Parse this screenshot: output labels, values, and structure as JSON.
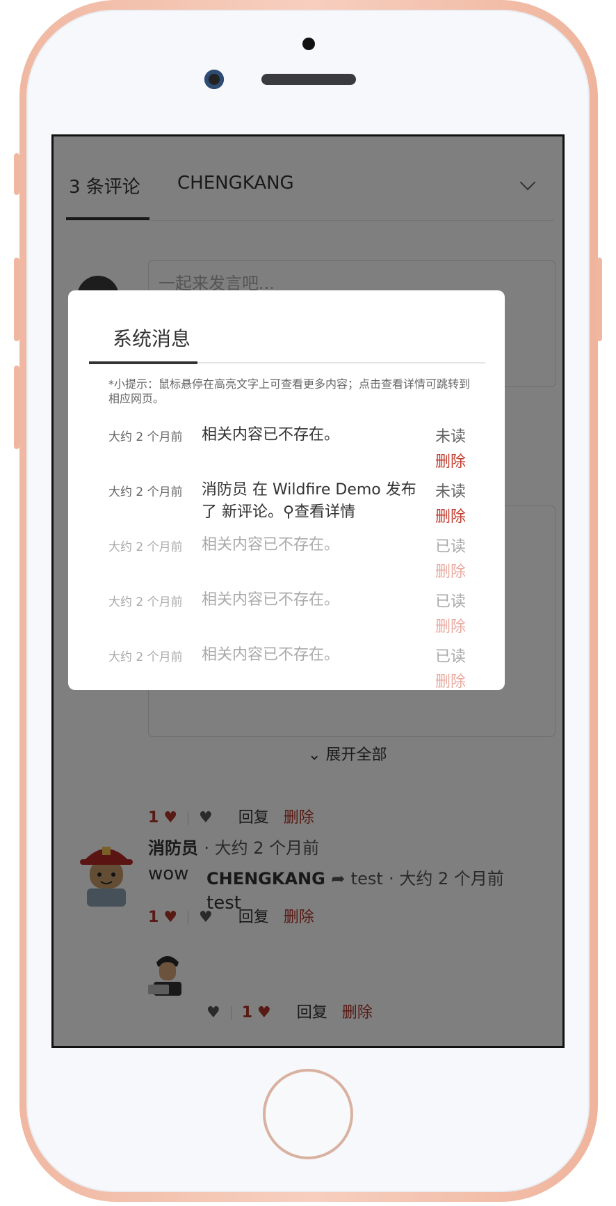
{
  "tabs": {
    "comments": "3 条评论",
    "user": "CHENGKANG"
  },
  "editor": {
    "placeholder": "一起来发言吧..."
  },
  "expand_all": "展开全部",
  "comments": [
    {
      "likes": "1",
      "reply": "回复",
      "delete": "删除"
    },
    {
      "author": "消防员",
      "time": "· 大约 2 个月前",
      "text": "wow",
      "likes": "1",
      "reply": "回复",
      "delete": "删除"
    },
    {
      "author": "CHENGKANG",
      "reply_to": "test",
      "time": "· 大约 2 个月前",
      "text": "test",
      "likes": "1",
      "reply": "回复",
      "delete": "删除"
    }
  ],
  "modal": {
    "title": "系统消息",
    "tip": "*小提示：鼠标悬停在高亮文字上可查看更多内容；点击查看详情可跳转到相应网页。",
    "messages": [
      {
        "time": "大约 2 个月前",
        "content": "相关内容已不存在。",
        "status": "未读",
        "delete": "删除"
      },
      {
        "time": "大约 2 个月前",
        "content": "消防员 在 Wildfire Demo 发布了 新评论。",
        "link": "查看详情",
        "status": "未读",
        "delete": "删除"
      },
      {
        "time": "大约 2 个月前",
        "content": "相关内容已不存在。",
        "status": "已读",
        "delete": "删除"
      },
      {
        "time": "大约 2 个月前",
        "content": "相关内容已不存在。",
        "status": "已读",
        "delete": "删除"
      },
      {
        "time": "大约 2 个月前",
        "content": "相关内容已不存在。",
        "status": "已读",
        "delete": "删除"
      }
    ]
  },
  "icons": {
    "heart": "heart-icon",
    "broken_heart": "broken-heart-icon",
    "chevron": "chevron-down-icon",
    "search": "search-icon",
    "share": "share-arrow-icon"
  },
  "colors": {
    "accent": "#b03428",
    "delete_unread": "#c0392b",
    "delete_read": "#e8a9a0",
    "phone_frame": "#f0b8a2"
  }
}
